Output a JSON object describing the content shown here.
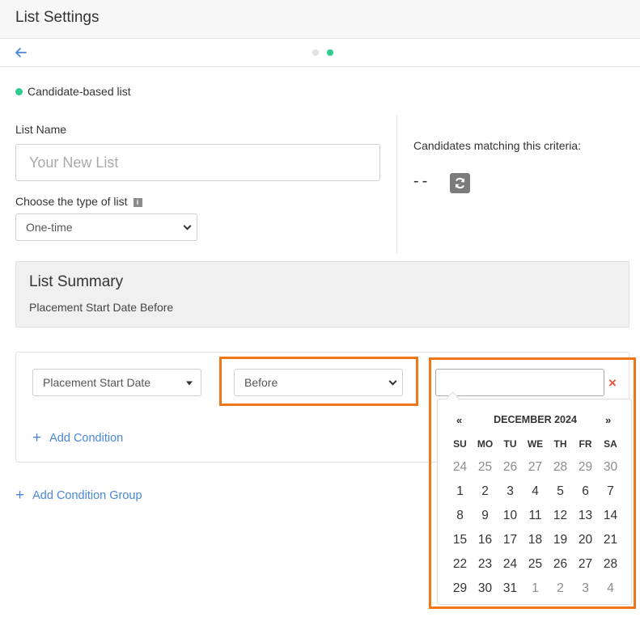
{
  "header": {
    "title": "List Settings"
  },
  "list_type": "Candidate-based list",
  "form": {
    "list_name_label": "List Name",
    "list_name_placeholder": "Your New List",
    "type_label": "Choose the type of list",
    "type_value": "One-time"
  },
  "criteria": {
    "label": "Candidates matching this criteria:",
    "count": "--"
  },
  "summary": {
    "title": "List Summary",
    "text": "Placement Start Date Before"
  },
  "condition": {
    "field": "Placement Start Date",
    "operator": "Before",
    "date_value": "",
    "clear": "×"
  },
  "links": {
    "add_condition": "Add Condition",
    "add_condition_group": "Add Condition Group",
    "plus": "+"
  },
  "calendar": {
    "prev": "«",
    "next": "»",
    "title": "DECEMBER 2024",
    "weekdays": [
      "SU",
      "MO",
      "TU",
      "WE",
      "TH",
      "FR",
      "SA"
    ],
    "weeks": [
      [
        {
          "d": "24",
          "m": true
        },
        {
          "d": "25",
          "m": true
        },
        {
          "d": "26",
          "m": true
        },
        {
          "d": "27",
          "m": true
        },
        {
          "d": "28",
          "m": true
        },
        {
          "d": "29",
          "m": true
        },
        {
          "d": "30",
          "m": true
        }
      ],
      [
        {
          "d": "1"
        },
        {
          "d": "2"
        },
        {
          "d": "3"
        },
        {
          "d": "4"
        },
        {
          "d": "5"
        },
        {
          "d": "6"
        },
        {
          "d": "7"
        }
      ],
      [
        {
          "d": "8"
        },
        {
          "d": "9"
        },
        {
          "d": "10"
        },
        {
          "d": "11"
        },
        {
          "d": "12"
        },
        {
          "d": "13"
        },
        {
          "d": "14"
        }
      ],
      [
        {
          "d": "15"
        },
        {
          "d": "16"
        },
        {
          "d": "17"
        },
        {
          "d": "18"
        },
        {
          "d": "19"
        },
        {
          "d": "20"
        },
        {
          "d": "21"
        }
      ],
      [
        {
          "d": "22"
        },
        {
          "d": "23"
        },
        {
          "d": "24"
        },
        {
          "d": "25"
        },
        {
          "d": "26"
        },
        {
          "d": "27"
        },
        {
          "d": "28"
        }
      ],
      [
        {
          "d": "29"
        },
        {
          "d": "30"
        },
        {
          "d": "31"
        },
        {
          "d": "1",
          "m": true
        },
        {
          "d": "2",
          "m": true
        },
        {
          "d": "3",
          "m": true
        },
        {
          "d": "4",
          "m": true
        }
      ]
    ]
  },
  "colors": {
    "accent_green": "#2ecc8f",
    "link_blue": "#4a86d8",
    "highlight_orange": "#f07618",
    "clear_red": "#e8553b"
  },
  "icons": {
    "back": "arrow-left-icon",
    "info": "info-icon",
    "refresh": "refresh-icon",
    "chevron": "chevron-down-icon"
  }
}
